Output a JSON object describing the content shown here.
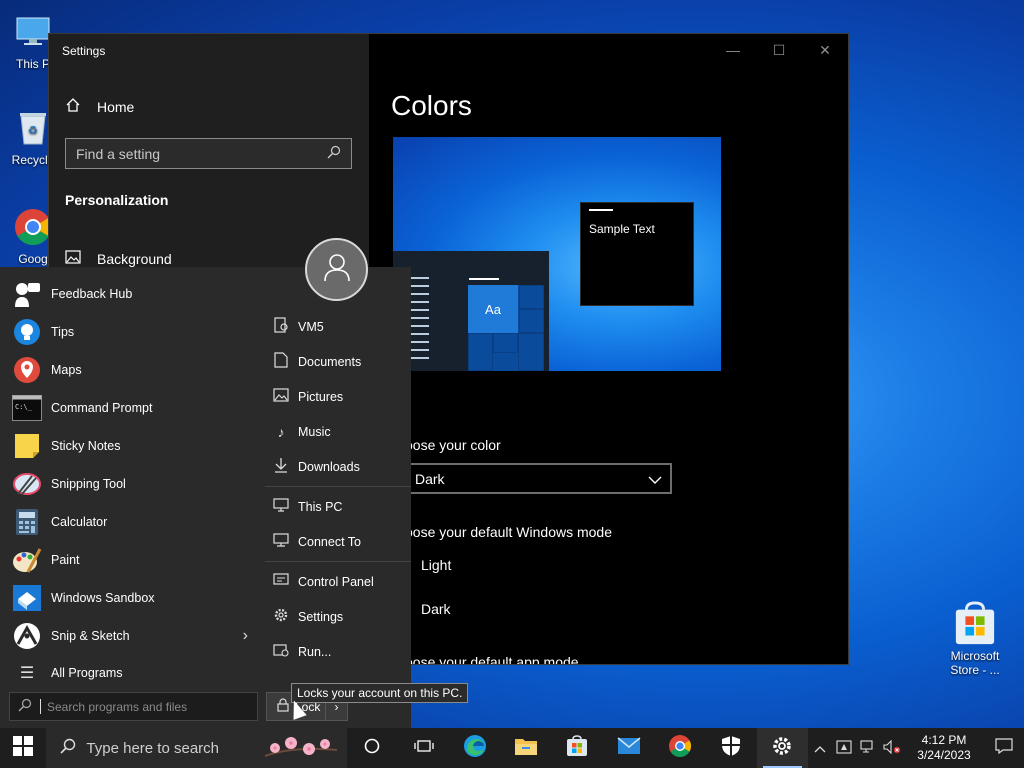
{
  "desktop": {
    "icons": [
      {
        "label": "This P"
      },
      {
        "label": "Recycle"
      },
      {
        "label": "Goog"
      },
      {
        "label": "Microsoft Store - ..."
      }
    ]
  },
  "settings": {
    "window_title": "Settings",
    "home_label": "Home",
    "find_placeholder": "Find a setting",
    "section": "Personalization",
    "nav_background": "Background",
    "page_title": "Colors",
    "sample_text": "Sample Text",
    "preview_aa": "Aa",
    "choose_color_label": "oose your color",
    "choose_color_value": "Dark",
    "windows_mode_label": "oose your default Windows mode",
    "mode_light": "Light",
    "mode_dark": "Dark",
    "app_mode_label": "oose your default app mode"
  },
  "start_menu": {
    "apps": [
      {
        "label": "Feedback Hub",
        "icon": "feedback-hub-icon"
      },
      {
        "label": "Tips",
        "icon": "tips-icon"
      },
      {
        "label": "Maps",
        "icon": "maps-icon"
      },
      {
        "label": "Command Prompt",
        "icon": "command-prompt-icon"
      },
      {
        "label": "Sticky Notes",
        "icon": "sticky-notes-icon"
      },
      {
        "label": "Snipping Tool",
        "icon": "snipping-tool-icon"
      },
      {
        "label": "Calculator",
        "icon": "calculator-icon"
      },
      {
        "label": "Paint",
        "icon": "paint-icon"
      },
      {
        "label": "Windows Sandbox",
        "icon": "windows-sandbox-icon"
      },
      {
        "label": "Snip & Sketch",
        "icon": "snip-sketch-icon"
      }
    ],
    "all_programs": "All Programs",
    "search_placeholder": "Search programs and files",
    "places": [
      {
        "label": "VM5"
      },
      {
        "label": "Documents"
      },
      {
        "label": "Pictures"
      },
      {
        "label": "Music"
      },
      {
        "label": "Downloads"
      },
      {
        "label": "This PC"
      },
      {
        "label": "Connect To"
      },
      {
        "label": "Control Panel"
      },
      {
        "label": "Settings"
      },
      {
        "label": "Run..."
      }
    ],
    "lock_label": "Lock",
    "lock_tooltip": "Locks your account on this PC."
  },
  "taskbar": {
    "search_placeholder": "Type here to search",
    "time": "4:12 PM",
    "date": "3/24/2023"
  },
  "colors": {
    "accent": "#0078d7",
    "start_bg": "#2a2a2a",
    "settings_nav_bg": "#1f1f1f"
  }
}
